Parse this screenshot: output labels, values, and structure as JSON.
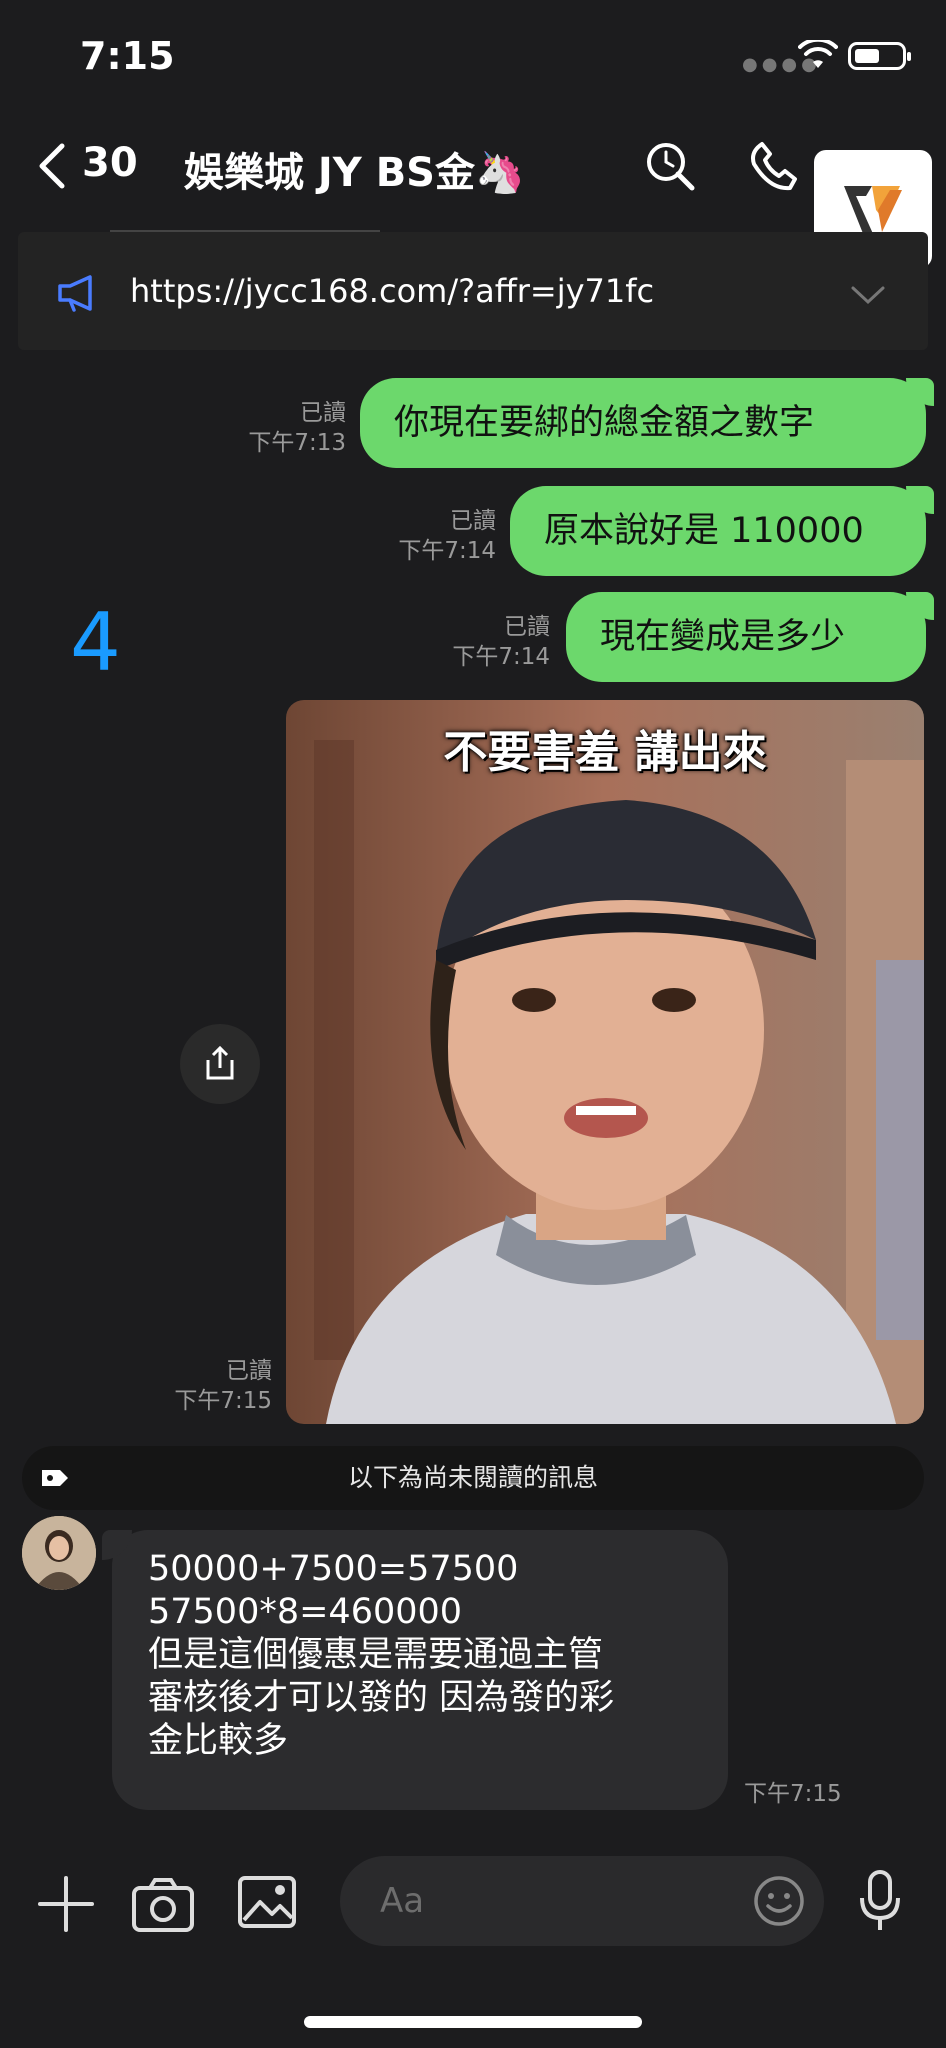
{
  "status_bar": {
    "time": "7:15"
  },
  "header": {
    "unread_count": "30",
    "title": "娛樂城 JY BS金🦄"
  },
  "announcement": {
    "url": "https://jycc168.com/?affr=jy71fc"
  },
  "messages_out": [
    {
      "text": "你現在要綁的總金額之數字",
      "status": "已讀",
      "time": "下午7:13"
    },
    {
      "text": "原本說好是 110000",
      "status": "已讀",
      "time": "下午7:14"
    },
    {
      "text": "現在變成是多少",
      "status": "已讀",
      "time": "下午7:14"
    }
  ],
  "side_number": "4",
  "image_message": {
    "caption": "不要害羞 講出來",
    "status": "已讀",
    "time": "下午7:15"
  },
  "unread_divider": "以下為尚未閱讀的訊息",
  "incoming": {
    "lines": [
      "50000+7500=57500",
      "57500*8=460000",
      "但是這個優惠是需要通過主管",
      "審核後才可以發的 因為發的彩",
      "金比較多"
    ],
    "time": "下午7:15"
  },
  "composer": {
    "placeholder": "Aa"
  },
  "colors": {
    "background": "#1c1c1e",
    "bubble_out": "#6cd86c",
    "bubble_in": "#2c2c2e",
    "accent_blue": "#1a9bff"
  }
}
